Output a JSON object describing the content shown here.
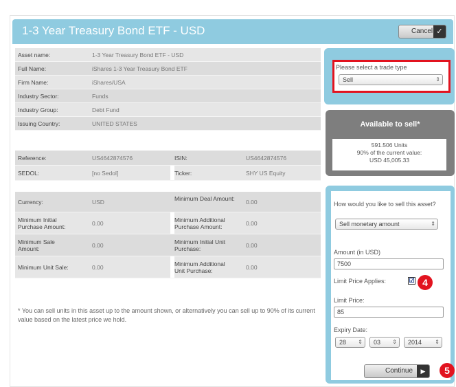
{
  "header": {
    "title": "1-3 Year Treasury Bond ETF - USD",
    "cancel_label": "Cancel"
  },
  "asset_info": [
    {
      "label": "Asset name:",
      "value": "1-3 Year Treasury Bond ETF - USD"
    },
    {
      "label": "Full Name:",
      "value": "iShares 1-3 Year Treasury Bond ETF"
    },
    {
      "label": "Firm Name:",
      "value": "iShares/USA"
    },
    {
      "label": "Industry Sector:",
      "value": "Funds"
    },
    {
      "label": "Industry Group:",
      "value": "Debt Fund"
    },
    {
      "label": "Issuing Country:",
      "value": "UNITED STATES"
    }
  ],
  "identifiers": [
    {
      "label1": "Reference:",
      "value1": "US4642874576",
      "label2": "ISIN:",
      "value2": "US4642874576"
    },
    {
      "label1": "SEDOL:",
      "value1": "[no Sedol]",
      "label2": "Ticker:",
      "value2": "SHY US Equity"
    }
  ],
  "limits": [
    {
      "label1": "Currency:",
      "value1": "USD",
      "label2": "Minimum Deal Amount:",
      "value2": "0.00"
    },
    {
      "label1": "Minimum Initial Purchase Amount:",
      "value1": "0.00",
      "label2": "Minimum Additional Purchase Amount:",
      "value2": "0.00"
    },
    {
      "label1": "Minimum Sale Amount:",
      "value1": "0.00",
      "label2": "Minimum Initial Unit Purchase:",
      "value2": "0.00"
    },
    {
      "label1": "Minimum Unit Sale:",
      "value1": "0.00",
      "label2": "Minimum Additional Unit Purchase:",
      "value2": "0.00"
    }
  ],
  "footnote": "* You can sell units in this asset up to the amount shown, or alternatively you can sell up to 90% of its current value based on the latest price we hold.",
  "trade_type": {
    "label": "Please select a trade type",
    "selected": "Sell"
  },
  "available": {
    "title": "Available to sell*",
    "units": "591.506 Units",
    "percent_text": "90% of the current value:",
    "value": "USD 45,005.33"
  },
  "sell_form": {
    "how_label": "How would you like to sell this asset?",
    "method_selected": "Sell monetary amount",
    "amount_label": "Amount (in USD)",
    "amount_value": "7500",
    "limit_label": "Limit Price Applies:",
    "limit_checked": "☑",
    "limit_price_label": "Limit Price:",
    "limit_price_value": "85",
    "expiry_label": "Expiry Date:",
    "expiry_day": "28",
    "expiry_month": "03",
    "expiry_year": "2014",
    "continue_label": "Continue"
  },
  "badges": {
    "step4": "4",
    "step5": "5"
  },
  "colors": {
    "header_blue": "#8fcbe0",
    "highlight_red": "#e2131f",
    "available_gray": "#7e7e7e"
  }
}
